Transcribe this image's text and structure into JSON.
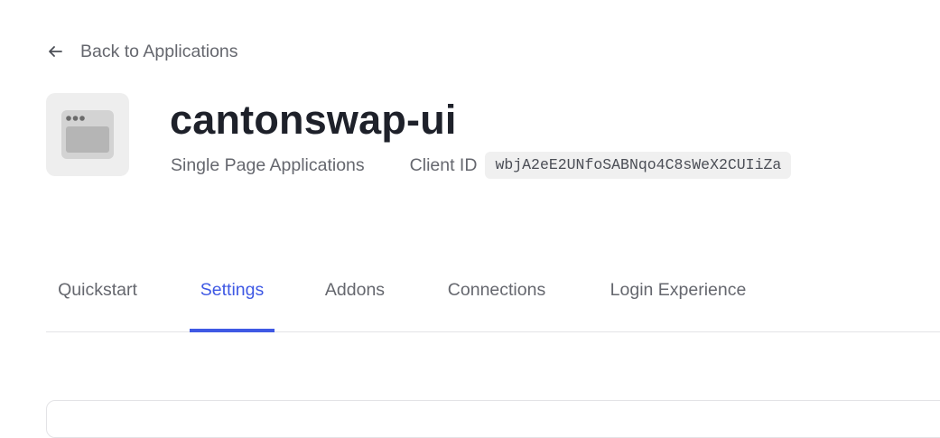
{
  "back_link": {
    "label": "Back to Applications",
    "icon": "arrow-left-icon"
  },
  "app": {
    "icon": "browser-window-icon",
    "name": "cantonswap-ui",
    "type": "Single Page Applications",
    "client_id_label": "Client ID",
    "client_id": "wbjA2eE2UNfoSABNqo4C8sWeX2CUIiZa"
  },
  "tabs": [
    {
      "label": "Quickstart",
      "active": false
    },
    {
      "label": "Settings",
      "active": true
    },
    {
      "label": "Addons",
      "active": false
    },
    {
      "label": "Connections",
      "active": false
    },
    {
      "label": "Login Experience",
      "active": false
    }
  ],
  "colors": {
    "accent": "#3f59e4",
    "text_primary": "#1e212a",
    "text_secondary": "#65676e",
    "tile_bg": "#eeeeee",
    "chip_bg": "#f0f0f0",
    "divider": "#e3e3e6"
  }
}
